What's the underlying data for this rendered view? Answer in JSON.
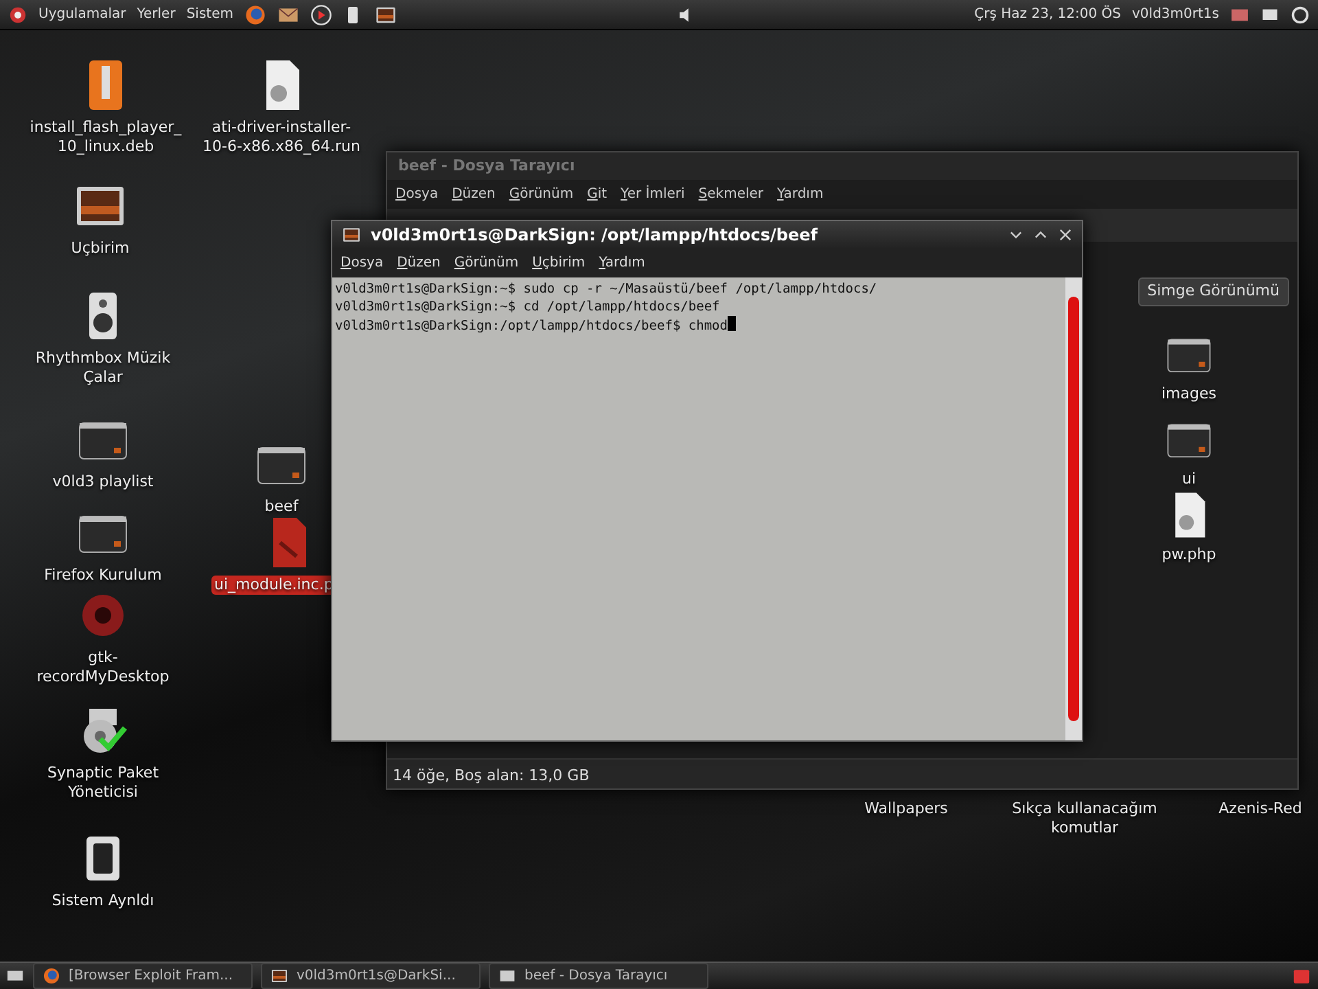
{
  "top_panel": {
    "menus": [
      "Uygulamalar",
      "Yerler",
      "Sistem"
    ],
    "clock": "Çrş Haz 23, 12:00 ÖS",
    "user": "v0ld3m0rt1s"
  },
  "desktop_icons": [
    {
      "label": "install_flash_player_ 10_linux.deb",
      "kind": "archive",
      "selected": false
    },
    {
      "label": "ati-driver-installer-10-6-x86.x86_64.run",
      "kind": "document",
      "selected": false
    },
    {
      "label": "Uçbirim",
      "kind": "terminal",
      "selected": false
    },
    {
      "label": "Rhythmbox Müzik Çalar",
      "kind": "speaker",
      "selected": false
    },
    {
      "label": "v0ld3 playlist",
      "kind": "folder",
      "selected": false
    },
    {
      "label": "beef",
      "kind": "folder",
      "selected": false
    },
    {
      "label": "Firefox Kurulum",
      "kind": "folder",
      "selected": false
    },
    {
      "label": "ui_module.inc.p",
      "kind": "php",
      "selected": true
    },
    {
      "label": "gtk-recordMyDesktop",
      "kind": "record",
      "selected": false
    },
    {
      "label": "Synaptic Paket Yöneticisi",
      "kind": "package",
      "selected": false
    },
    {
      "label": "Sistem Aynldı",
      "kind": "power",
      "selected": false
    },
    {
      "label": "Wallpapers",
      "kind": "hidden",
      "selected": false
    },
    {
      "label": "Sıkça kullanacağım komutlar",
      "kind": "hidden",
      "selected": false
    },
    {
      "label": "Azenis-Red",
      "kind": "hidden",
      "selected": false
    }
  ],
  "file_manager": {
    "title": "beef - Dosya Tarayıcı",
    "menu": [
      "Dosya",
      "Düzen",
      "Görünüm",
      "Git",
      "Yer İmleri",
      "Sekmeler",
      "Yardım"
    ],
    "view_select": "Simge Görünümü",
    "items": [
      {
        "label": "images",
        "kind": "folder"
      },
      {
        "label": "ui",
        "kind": "folder"
      },
      {
        "label": "pw.php",
        "kind": "document"
      }
    ],
    "status": "14 öğe, Boş alan: 13,0 GB"
  },
  "terminal": {
    "title": "v0ld3m0rt1s@DarkSign: /opt/lampp/htdocs/beef",
    "menu": [
      "Dosya",
      "Düzen",
      "Görünüm",
      "Uçbirim",
      "Yardım"
    ],
    "lines": [
      "v0ld3m0rt1s@DarkSign:~$ sudo cp -r ~/Masaüstü/beef /opt/lampp/htdocs/",
      "v0ld3m0rt1s@DarkSign:~$ cd /opt/lampp/htdocs/beef",
      "v0ld3m0rt1s@DarkSign:/opt/lampp/htdocs/beef$ chmod"
    ]
  },
  "taskbar": [
    {
      "label": "[Browser Exploit Fram...",
      "kind": "browser"
    },
    {
      "label": "v0ld3m0rt1s@DarkSi...",
      "kind": "terminal"
    },
    {
      "label": "beef - Dosya Tarayıcı",
      "kind": "files"
    }
  ]
}
